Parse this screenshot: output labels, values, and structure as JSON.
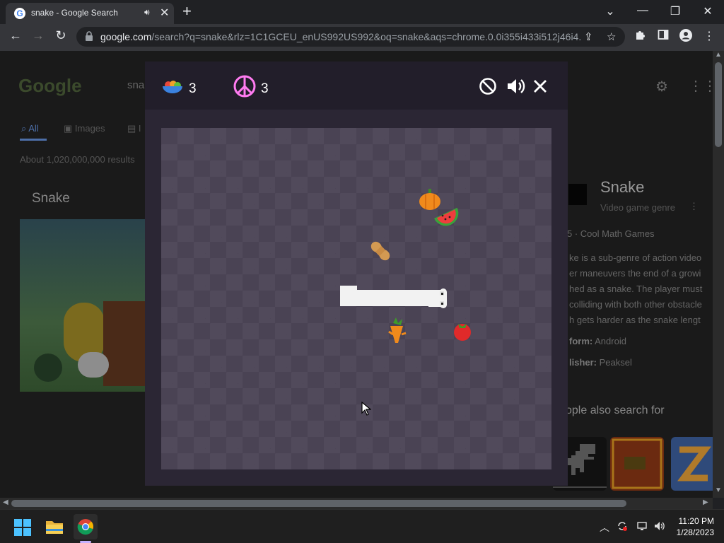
{
  "browser": {
    "tab_title": "snake - Google Search",
    "favicon_letter": "G",
    "audio_icon": "speaker-icon",
    "close_tab_glyph": "✕",
    "new_tab_glyph": "+",
    "window_controls": [
      "⌄",
      "—",
      "❐",
      "✕"
    ],
    "url_domain": "google.com",
    "url_rest": "/search?q=snake&rlz=1C1GCEU_enUS992US992&oq=snake&aqs=chrome.0.0i355i433i512j46i4..."
  },
  "page": {
    "logo_text": "Google",
    "search_fragment": "sna",
    "tabs": [
      "All",
      "Images",
      "I"
    ],
    "results_count": "About 1,020,000,000 results",
    "heading": "Snake",
    "knowledge_panel": {
      "title": "Snake",
      "subtitle": "Video game genre",
      "rating_source": "5 · Cool Math Games",
      "description_lines": [
        "ke is a sub-genre of action video",
        "er maneuvers the end of a growi",
        "hed as a snake. The player must",
        "colliding with both other obstacle",
        "h gets harder as the snake lengt"
      ],
      "platform_label": "form:",
      "platform_value": "Android",
      "publisher_label": "lisher:",
      "publisher_value": "Peaksel",
      "people_also_search": "ople also search for"
    }
  },
  "game": {
    "fruit_count": "3",
    "peace_count": "3",
    "colors": {
      "board_dark": "#4a4354",
      "board_light": "#514a5b",
      "header": "#221e2a",
      "snake": "#f2f2f2"
    },
    "items": [
      {
        "name": "pumpkin",
        "icon": "pumpkin-icon"
      },
      {
        "name": "watermelon",
        "icon": "watermelon-icon"
      },
      {
        "name": "peanut",
        "icon": "peanut-icon"
      },
      {
        "name": "carrot",
        "icon": "carrot-icon"
      },
      {
        "name": "tomato",
        "icon": "tomato-icon"
      }
    ]
  },
  "taskbar": {
    "time": "11:20 PM",
    "date": "1/28/2023"
  }
}
